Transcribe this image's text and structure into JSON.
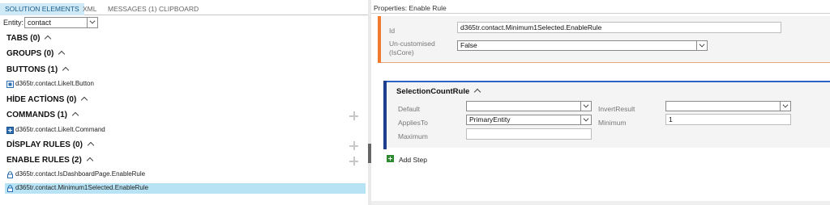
{
  "tabs": [
    {
      "label": "SOLUTION ELEMENTS",
      "active": true
    },
    {
      "label": "XML",
      "active": false
    },
    {
      "label": "MESSAGES (1)",
      "active": false
    },
    {
      "label": "CLIPBOARD",
      "active": false
    }
  ],
  "entity": {
    "label": "Entity:",
    "value": "contact"
  },
  "sections": {
    "tabs": "TABS (0)",
    "groups": "GROUPS (0)",
    "buttons": "BUTTONS (1)",
    "hide_actions": "HİDE ACTİONS (0)",
    "commands": "COMMANDS (1)",
    "display_rules": "DİSPLAY RULES (0)",
    "enable_rules": "ENABLE RULES (2)"
  },
  "items": {
    "button": "d365tr.contact.LikeIt.Button",
    "command": "d365tr.contact.LikeIt.Command",
    "enable_rule_1": "d365tr.contact.IsDashboardPage.EnableRule",
    "enable_rule_2": "d365tr.contact.Minimum1Selected.EnableRule"
  },
  "properties": {
    "title": "Properties: Enable Rule",
    "id_label": "Id",
    "id_value": "d365tr.contact.Minimum1Selected.EnableRule",
    "uncustomised_label_1": "Un-customised",
    "uncustomised_label_2": "(IsCore)",
    "uncustomised_value": "False"
  },
  "selection_rule": {
    "title": "SelectionCountRule",
    "default_label": "Default",
    "default_value": "",
    "invert_label": "InvertResult",
    "invert_value": "",
    "applies_label": "AppliesTo",
    "applies_value": "PrimaryEntity",
    "minimum_label": "Minimum",
    "minimum_value": "1",
    "maximum_label": "Maximum",
    "maximum_value": ""
  },
  "add_step_label": "Add Step",
  "colors": {
    "active_tab_bg": "#cfe9f7",
    "selected_row_bg": "#b7e3f5",
    "rule_accent": "#f07a2d",
    "step_accent": "#1e3d8c",
    "step_border": "#2c62c9",
    "add_icon": "#2e8a2e"
  },
  "icons": {
    "button": "button-icon",
    "command": "command-icon",
    "enable_rule": "lock-icon",
    "add": "plus-icon"
  }
}
